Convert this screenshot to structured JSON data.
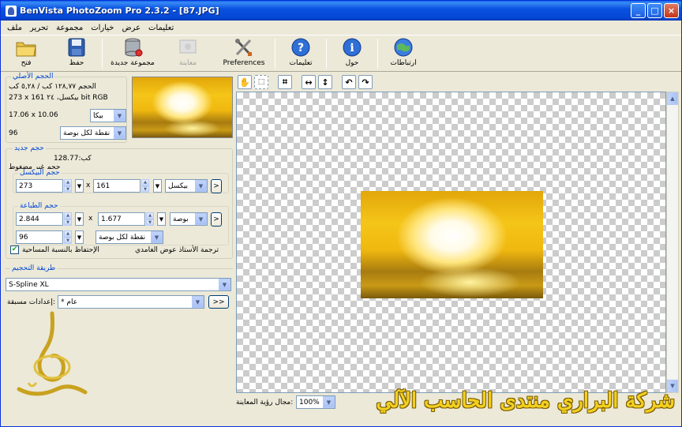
{
  "window": {
    "title": "BenVista PhotoZoom Pro 2.3.2 - [87.JPG]",
    "buttons": [
      "_",
      "□",
      "×"
    ]
  },
  "menu": [
    "ملف",
    "تحرير",
    "مجموعة",
    "خيارات",
    "عرض",
    "تعليمات"
  ],
  "toolbar": {
    "open": "فتح",
    "save": "حفظ",
    "batch": "مجموعة جديدة",
    "preview": "معاينة",
    "preferences": "Preferences",
    "help": "تعليمات",
    "about": "حول",
    "links": "ارتباطات"
  },
  "original": {
    "legend": "الحجم الأصلي",
    "size_line": "الحجم ١٢٨,٧٧ كب / ٥,٢٨ كب",
    "dims_line": "273 x 161 بيكسل، ٢٤ bit RGB",
    "print_size": "17.06 x 10.06",
    "unit": "بيكا",
    "res_value": "96",
    "res_unit": "نقطة لكل بوصة"
  },
  "new_size": {
    "legend": "حجم جديد",
    "size_kb": "128.77:كب",
    "uncompressed": "حجم غير مضغوط",
    "pixel_legend": "حجم البيكسل",
    "width_px": "273",
    "height_px": "161",
    "px_unit": "بيكسل",
    "x_sep": "x",
    "print_legend": "حجم الطباعة",
    "width_print": "2.844",
    "height_print": "1.677",
    "print_unit": "بوصة",
    "resolution": "96",
    "res_unit": "نقطة لكل بوصة",
    "arrow_btn": ">",
    "keep_ratio": "الإحتفاظ بالنسبة المساحية",
    "translate_label": "ترجمة الأستاذ عوض الغامدي"
  },
  "method": {
    "legend": "طريقة التحجيم",
    "value": "S-Spline XL",
    "presets_label": "إعدادات مسبقة:",
    "presets_value": "* عام",
    "presets_btn": ">>"
  },
  "preview": {
    "zoom_label": "مجال رؤية المعاينة:",
    "zoom_value": "100%"
  },
  "watermark": "شركة البراري منتدى الحاسب الآلي",
  "colors": {
    "titlebar": "#0a53e0",
    "legend": "#0046d5",
    "watermark": "#f2d020"
  }
}
